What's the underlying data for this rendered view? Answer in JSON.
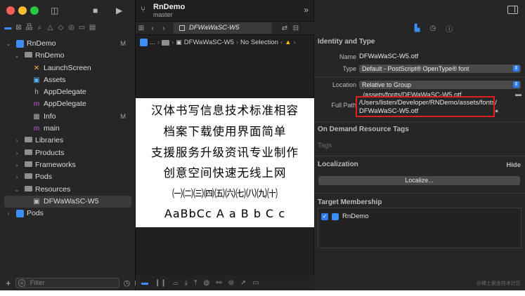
{
  "navigator": {
    "filter_placeholder": "Filter",
    "tree": [
      {
        "label": "RnDemo",
        "indent": 0,
        "chev": "⌄",
        "icon": "project-icon",
        "flag": "M"
      },
      {
        "label": "RnDemo",
        "indent": 1,
        "chev": "⌄",
        "icon": "folder-icon",
        "flag": ""
      },
      {
        "label": "LaunchScreen",
        "indent": 2,
        "chev": "",
        "icon": "storyboard-icon",
        "flag": ""
      },
      {
        "label": "Assets",
        "indent": 2,
        "chev": "",
        "icon": "assets-icon",
        "flag": ""
      },
      {
        "label": "AppDelegate",
        "indent": 2,
        "chev": "",
        "icon": "header-file-icon",
        "flag": ""
      },
      {
        "label": "AppDelegate",
        "indent": 2,
        "chev": "",
        "icon": "objc-file-icon",
        "flag": ""
      },
      {
        "label": "Info",
        "indent": 2,
        "chev": "",
        "icon": "plist-icon",
        "flag": "M"
      },
      {
        "label": "main",
        "indent": 2,
        "chev": "",
        "icon": "objc-file-icon",
        "flag": ""
      },
      {
        "label": "Libraries",
        "indent": 1,
        "chev": "›",
        "icon": "folder-icon",
        "flag": ""
      },
      {
        "label": "Products",
        "indent": 1,
        "chev": "›",
        "icon": "folder-icon",
        "flag": ""
      },
      {
        "label": "Frameworks",
        "indent": 1,
        "chev": "›",
        "icon": "folder-icon",
        "flag": ""
      },
      {
        "label": "Pods",
        "indent": 1,
        "chev": "›",
        "icon": "folder-icon",
        "flag": ""
      },
      {
        "label": "Resources",
        "indent": 1,
        "chev": "⌄",
        "icon": "folder-icon",
        "flag": ""
      },
      {
        "label": "DFWaWaSC-W5",
        "indent": 2,
        "chev": "",
        "icon": "font-file-icon",
        "flag": "",
        "selected": true
      },
      {
        "label": "Pods",
        "indent": 0,
        "chev": "›",
        "icon": "project-icon",
        "flag": ""
      }
    ]
  },
  "editor": {
    "scheme_name": "RnDemo",
    "scheme_branch": "master",
    "tab_label": "DFWaWaSC-W5",
    "jump_bar": {
      "ellipsis": "...",
      "file": "DFWaWaSC-W5",
      "selection": "No Selection"
    },
    "preview_lines": [
      "汉体书写信息技术标准相容",
      "档案下载使用界面简单",
      "支援服务升级资讯专业制作",
      "创意空间快速无线上网",
      "㈠㈡㈢㈣㈤㈥㈦㈧㈨㈩",
      "AaBbCc A a B b C c"
    ]
  },
  "inspector": {
    "identity": {
      "heading": "Identity and Type",
      "name_label": "Name",
      "name_value": "DFWaWaSC-W5.otf",
      "type_label": "Type",
      "type_value": "Default - PostScript® OpenType® font",
      "location_label": "Location",
      "location_value": "Relative to Group",
      "location_path": "../assets/fonts/DFWaWaSC-W5.otf",
      "fullpath_label": "Full Path",
      "fullpath_line1": "/Users/listen/Developer/RNDemo/assets/fonts/",
      "fullpath_line2": "DFWaWaSC-W5.otf"
    },
    "on_demand": {
      "heading": "On Demand Resource Tags",
      "placeholder": "Tags"
    },
    "localization": {
      "heading": "Localization",
      "hide_label": "Hide",
      "button_label": "Localize..."
    },
    "membership": {
      "heading": "Target Membership",
      "target": "RnDemo"
    },
    "watermark": "@稀土掘金技术社区"
  },
  "colors": {
    "accent": "#3f8cff",
    "highlight_box": "#e02020",
    "window_bg": "#1e1e1e"
  }
}
